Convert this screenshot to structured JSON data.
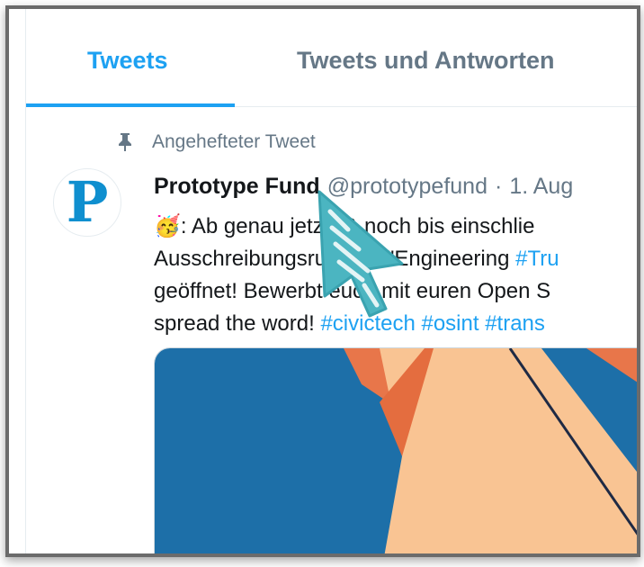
{
  "tabs": [
    {
      "label": "Tweets",
      "active": true
    },
    {
      "label": "Tweets und Antworten",
      "active": false
    }
  ],
  "pinned": {
    "label": "Angehefteter Tweet",
    "icon": "pin-icon"
  },
  "tweet": {
    "avatar_letter": "P",
    "author": "Prototype Fund",
    "handle": "@prototypefund",
    "separator": "·",
    "date": "1. Aug",
    "lines": [
      {
        "emoji": "🥳",
        "text": ": Ab genau jetzt* & noch bis einschlie"
      },
      {
        "text": "Ausschreibungsrunde 7 \"Engineering ",
        "hashtag": "#Tru"
      },
      {
        "text": "geöffnet! Bewerbt euch mit euren Open S"
      },
      {
        "text": "spread the word!  ",
        "hashtags": [
          "#civictech",
          "#osint",
          "#trans"
        ]
      }
    ]
  },
  "colors": {
    "accent": "#1da1f2",
    "muted": "#657786",
    "text": "#14171a",
    "cursor": "#4bb5c1"
  }
}
